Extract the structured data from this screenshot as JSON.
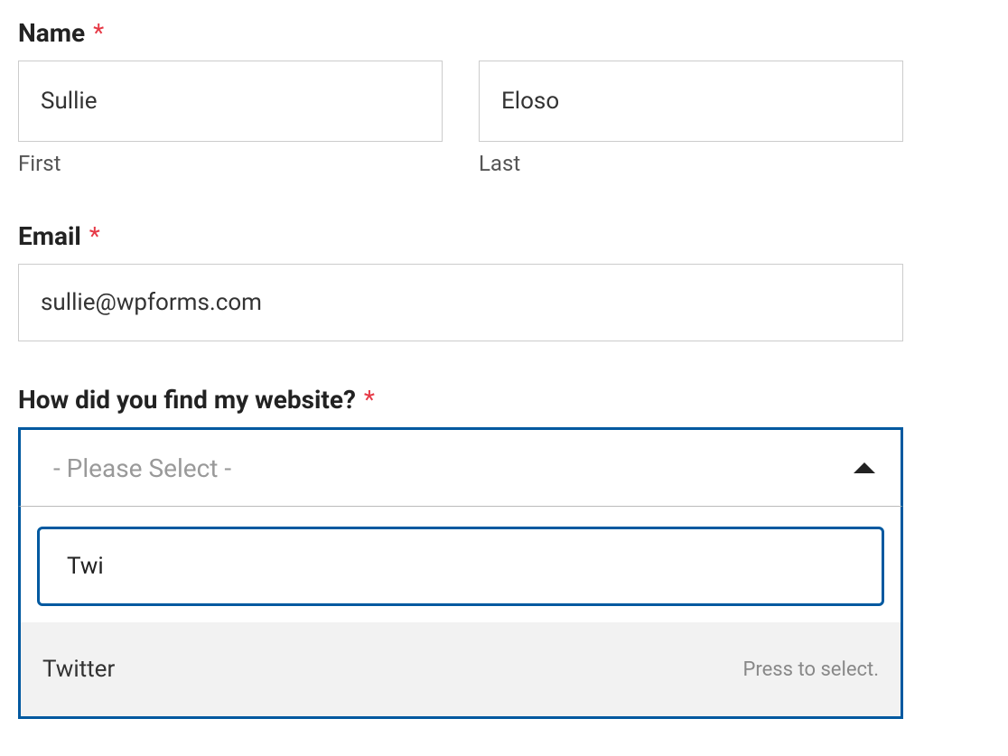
{
  "name": {
    "label": "Name",
    "required_marker": "*",
    "first_value": "Sullie",
    "first_sublabel": "First",
    "last_value": "Eloso",
    "last_sublabel": "Last"
  },
  "email": {
    "label": "Email",
    "required_marker": "*",
    "value": "sullie@wpforms.com"
  },
  "dropdown": {
    "label": "How did you find my website?",
    "required_marker": "*",
    "placeholder": "- Please Select -",
    "search_value": "Twi",
    "option_label": "Twitter",
    "option_hint": "Press to select."
  }
}
